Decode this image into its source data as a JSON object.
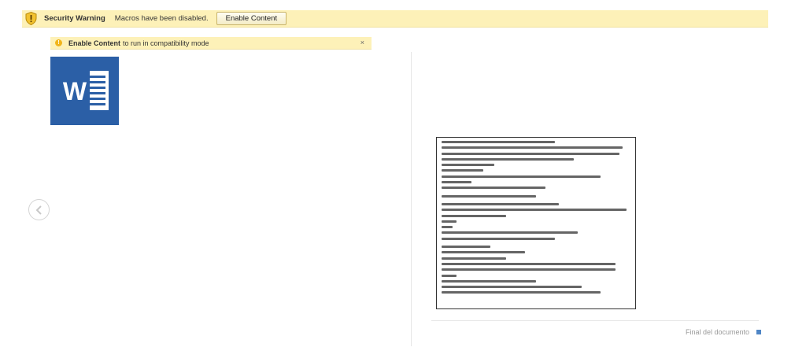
{
  "security_bar": {
    "title": "Security Warning",
    "message": "Macros have been disabled.",
    "button_label": "Enable Content"
  },
  "compat_bar": {
    "strong": "Enable Content",
    "rest": "to run in compatibility mode",
    "close": "×"
  },
  "word_icon": {
    "letter": "W"
  },
  "footer": {
    "end_label": "Final del documento"
  },
  "colors": {
    "warning_bg": "#fdf1b8",
    "word_blue": "#2b5fa6",
    "end_marker": "#4f86c6"
  }
}
